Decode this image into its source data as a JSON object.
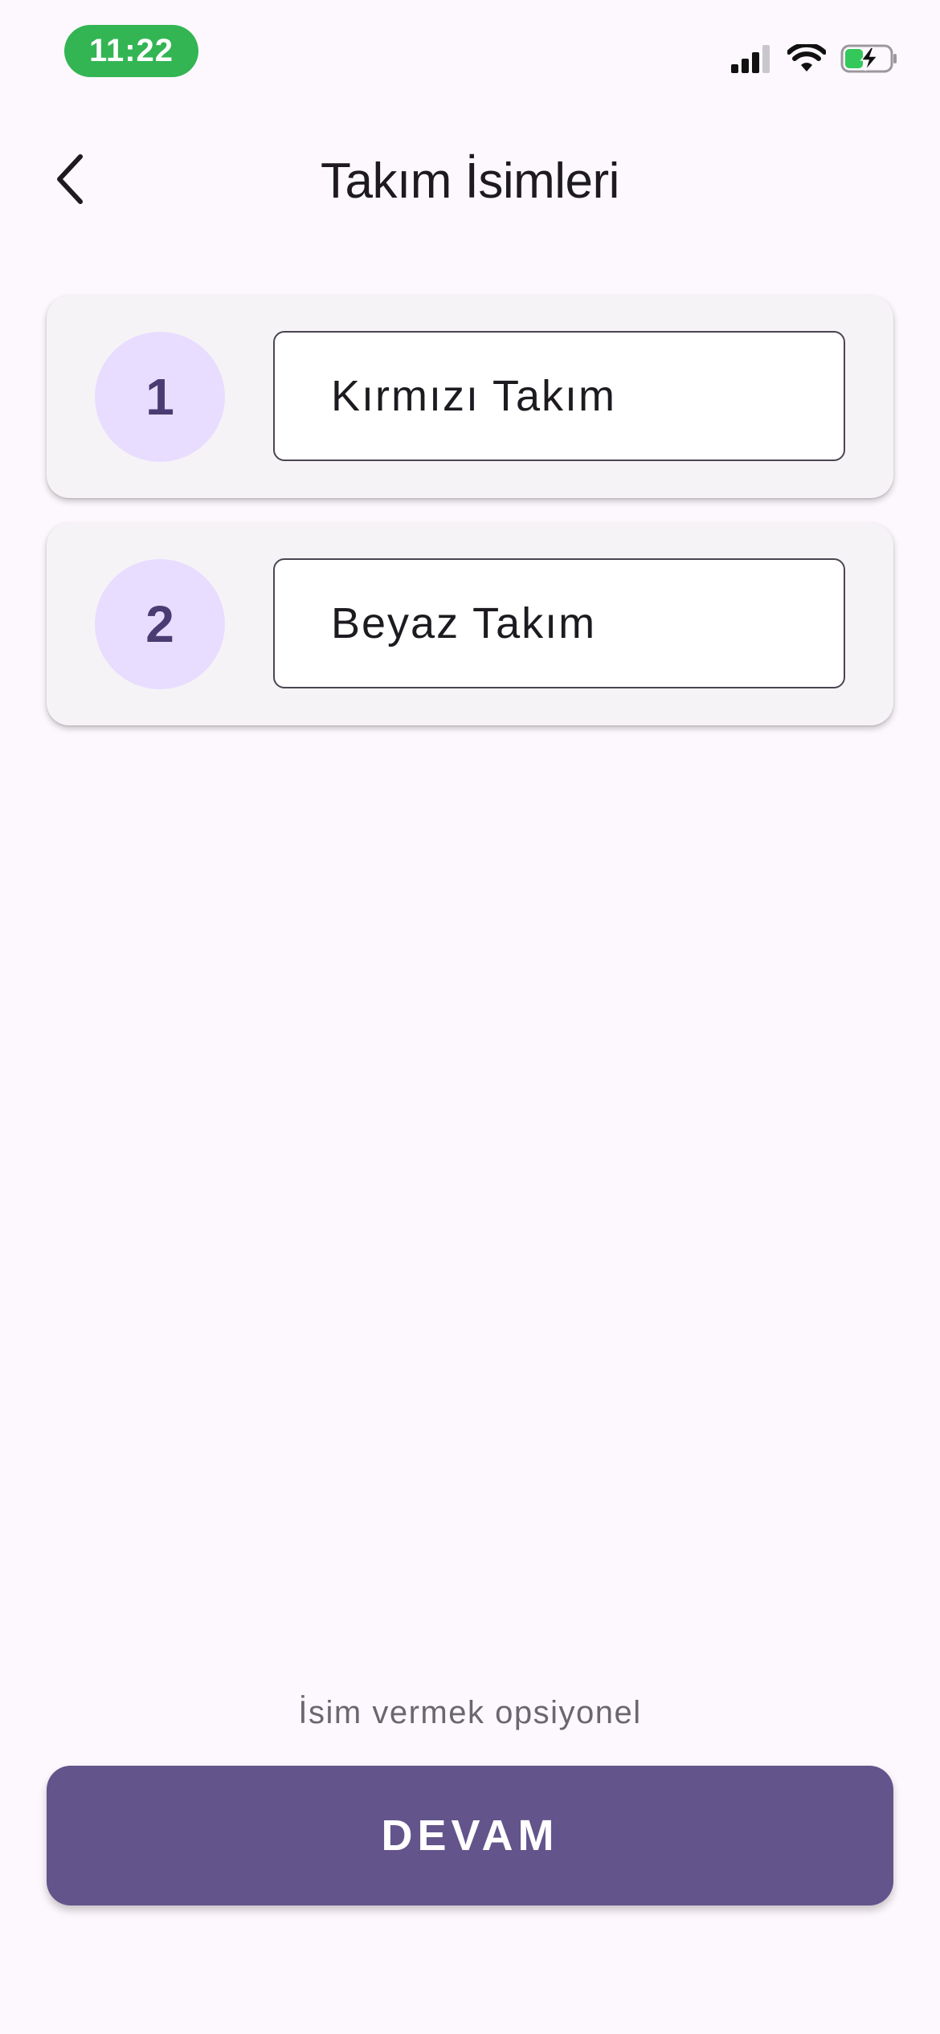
{
  "status_bar": {
    "time": "11:22",
    "time_pill_color": "#34b553",
    "icons": [
      "cellular-signal-icon",
      "wifi-icon",
      "battery-charging-icon"
    ]
  },
  "header": {
    "back_icon": "chevron-left-icon",
    "title": "Takım İsimleri"
  },
  "teams": [
    {
      "number": "1",
      "name": "Kırmızı Takım"
    },
    {
      "number": "2",
      "name": "Beyaz Takım"
    }
  ],
  "footer": {
    "hint": "İsim vermek opsiyonel",
    "continue_label": "DEVAM"
  },
  "colors": {
    "background": "#fdf8fd",
    "card": "#f6f3f7",
    "badge": "#e9ddff",
    "badge_text": "#4a3b73",
    "primary": "#64548c"
  }
}
